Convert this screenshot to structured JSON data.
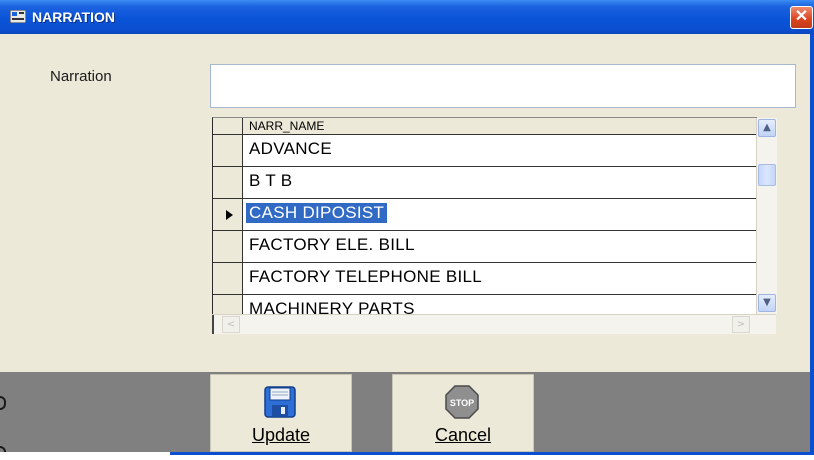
{
  "window": {
    "title": "NARRATION",
    "close_glyph": "✕"
  },
  "form": {
    "narration_label": "Narration",
    "narration_value": "",
    "narration_placeholder": ""
  },
  "grid": {
    "column_header": "NARR_NAME",
    "selected_index": 2,
    "rows": [
      {
        "name": "ADVANCE"
      },
      {
        "name": "B T B"
      },
      {
        "name": "CASH DIPOSIST"
      },
      {
        "name": "FACTORY ELE. BILL"
      },
      {
        "name": "FACTORY TELEPHONE BILL"
      },
      {
        "name": "MACHINERY PARTS"
      }
    ],
    "scroll_up_glyph": "︿",
    "scroll_down_glyph": "﹀",
    "scroll_left_glyph": "<",
    "scroll_right_glyph": ">"
  },
  "toolbar": {
    "update_label": "Update",
    "update_icon": "floppy-disk-icon",
    "cancel_label": "Cancel",
    "cancel_icon": "stop-sign-icon",
    "stop_text": "STOP"
  },
  "colors": {
    "titlebar": "#0b4fd0",
    "selection": "#316ac5",
    "window_bg": "#ece9d8",
    "toolbar_bg": "#808080",
    "close": "#d9441e"
  }
}
